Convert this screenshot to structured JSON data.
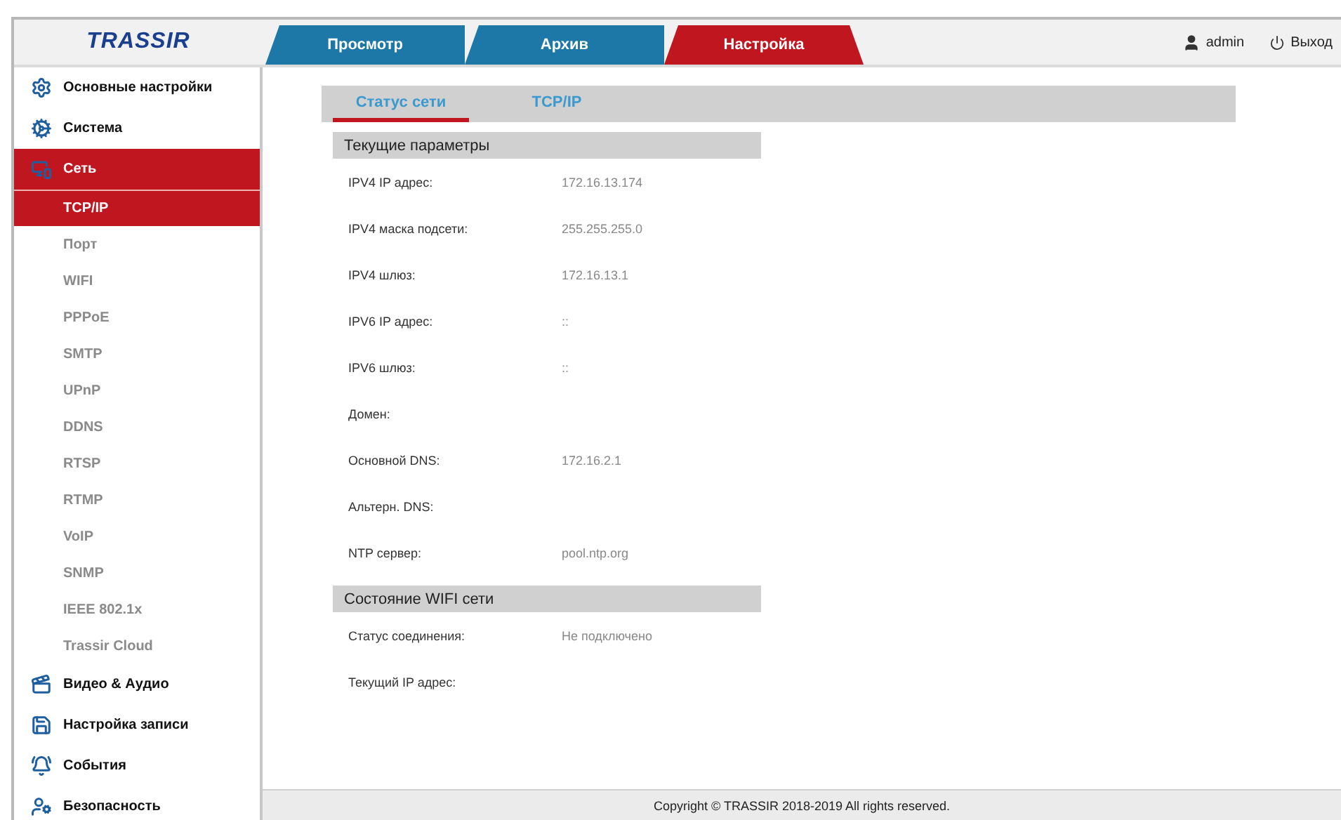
{
  "logo": "TRASSIR",
  "nav_tabs": [
    {
      "label": "Просмотр",
      "selected": false
    },
    {
      "label": "Архив",
      "selected": false
    },
    {
      "label": "Настройка",
      "selected": true
    }
  ],
  "user": {
    "name": "admin",
    "logout": "Выход"
  },
  "sidebar": {
    "items": [
      {
        "kind": "group",
        "label": "Основные настройки",
        "selected": false
      },
      {
        "kind": "group",
        "label": "Система",
        "selected": false
      },
      {
        "kind": "group",
        "label": "Сеть",
        "selected": true
      },
      {
        "kind": "sub",
        "label": "TCP/IP",
        "selected": true
      },
      {
        "kind": "sub",
        "label": "Порт",
        "selected": false
      },
      {
        "kind": "sub",
        "label": "WIFI",
        "selected": false
      },
      {
        "kind": "sub",
        "label": "PPPoE",
        "selected": false
      },
      {
        "kind": "sub",
        "label": "SMTP",
        "selected": false
      },
      {
        "kind": "sub",
        "label": "UPnP",
        "selected": false
      },
      {
        "kind": "sub",
        "label": "DDNS",
        "selected": false
      },
      {
        "kind": "sub",
        "label": "RTSP",
        "selected": false
      },
      {
        "kind": "sub",
        "label": "RTMP",
        "selected": false
      },
      {
        "kind": "sub",
        "label": "VoIP",
        "selected": false
      },
      {
        "kind": "sub",
        "label": "SNMP",
        "selected": false
      },
      {
        "kind": "sub",
        "label": "IEEE 802.1x",
        "selected": false
      },
      {
        "kind": "sub",
        "label": "Trassir Cloud",
        "selected": false
      },
      {
        "kind": "group",
        "label": "Видео & Аудио",
        "selected": false
      },
      {
        "kind": "group",
        "label": "Настройка записи",
        "selected": false
      },
      {
        "kind": "group",
        "label": "События",
        "selected": false
      },
      {
        "kind": "group",
        "label": "Безопасность",
        "selected": false
      }
    ]
  },
  "sub_tabs": [
    {
      "label": "Статус сети",
      "selected": true
    },
    {
      "label": "TCP/IP",
      "selected": false
    }
  ],
  "sections": [
    {
      "title": "Текущие параметры",
      "rows": [
        {
          "label": "IPV4 IP адрес:",
          "value": "172.16.13.174"
        },
        {
          "label": "IPV4 маска подсети:",
          "value": "255.255.255.0"
        },
        {
          "label": "IPV4 шлюз:",
          "value": "172.16.13.1"
        },
        {
          "label": "IPV6 IP адрес:",
          "value": "::"
        },
        {
          "label": "IPV6 шлюз:",
          "value": "::"
        },
        {
          "label": "Домен:"
        },
        {
          "label": "Основной DNS:",
          "value": "172.16.2.1"
        },
        {
          "label": "Альтерн. DNS:"
        },
        {
          "label": "NTP сервер:",
          "value": "pool.ntp.org"
        }
      ]
    },
    {
      "title": "Состояние WIFI сети",
      "rows": [
        {
          "label": "Статус соединения:",
          "value": "Не подключено"
        },
        {
          "label": "Текущий IP адрес:"
        }
      ]
    }
  ],
  "footer": "Copyright © TRASSIR 2018-2019 All rights reserved."
}
